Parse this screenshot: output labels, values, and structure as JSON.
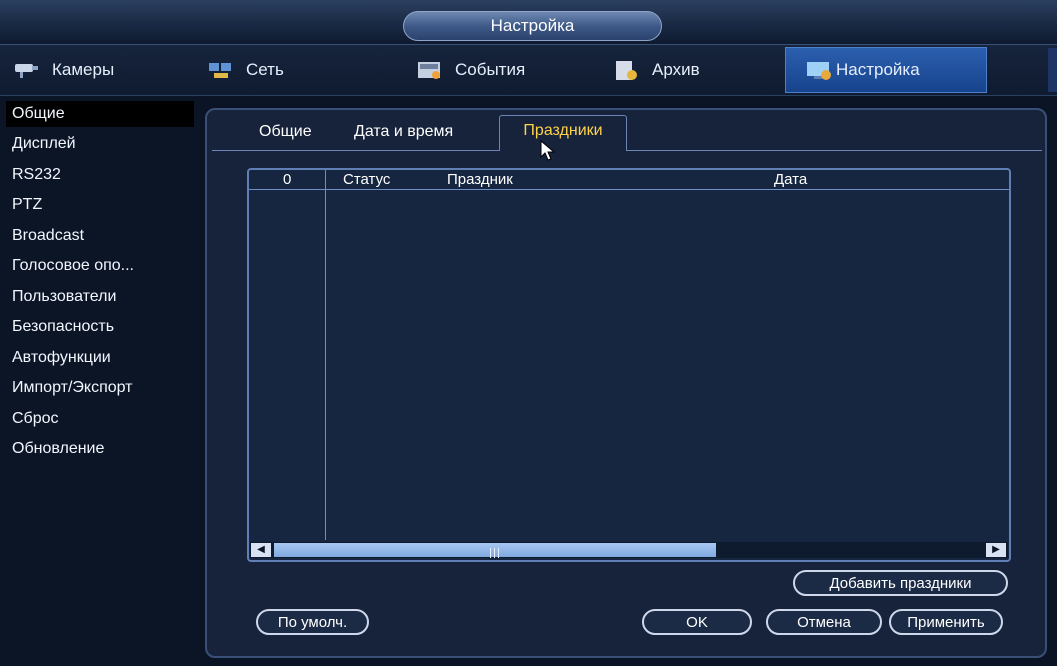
{
  "window": {
    "title": "Настройка"
  },
  "top_tabs": [
    {
      "label": "Камеры",
      "icon": "camera-icon"
    },
    {
      "label": "Сеть",
      "icon": "network-icon"
    },
    {
      "label": "События",
      "icon": "events-icon"
    },
    {
      "label": "Архив",
      "icon": "archive-icon"
    },
    {
      "label": "Настройка",
      "icon": "settings-icon",
      "active": true
    }
  ],
  "sidebar": {
    "items": [
      {
        "label": "Общие",
        "active": true
      },
      {
        "label": "Дисплей"
      },
      {
        "label": "RS232"
      },
      {
        "label": "PTZ"
      },
      {
        "label": "Broadcast"
      },
      {
        "label": "Голосовое опо..."
      },
      {
        "label": "Пользователи"
      },
      {
        "label": "Безопасность"
      },
      {
        "label": "Автофункции"
      },
      {
        "label": "Импорт/Экспорт"
      },
      {
        "label": "Сброс"
      },
      {
        "label": "Обновление"
      }
    ]
  },
  "subtabs": [
    {
      "label": "Общие"
    },
    {
      "label": "Дата и время"
    },
    {
      "label": "Праздники",
      "active": true
    }
  ],
  "table": {
    "columns": [
      "0",
      "Статус",
      "Праздник",
      "Дата"
    ],
    "rows": []
  },
  "buttons": {
    "add_holidays": "Добавить праздники",
    "default": "По умолч.",
    "ok": "OK",
    "cancel": "Отмена",
    "apply": "Применить"
  },
  "colors": {
    "active_tab_text": "#ffd24a",
    "active_top_tab": "#2b5faf",
    "background": "#0b1424"
  }
}
